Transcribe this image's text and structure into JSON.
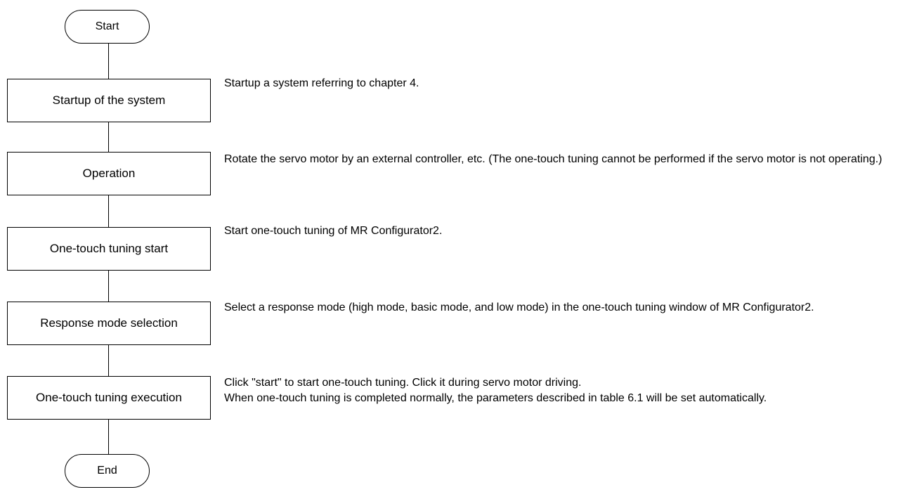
{
  "flowchart": {
    "start_label": "Start",
    "end_label": "End",
    "steps": [
      {
        "label": "Startup of the system",
        "description": [
          "Startup a system referring to chapter 4."
        ]
      },
      {
        "label": "Operation",
        "description": [
          "Rotate the servo motor by an external controller, etc. (The one-touch tuning cannot be performed if the servo motor is not operating.)"
        ]
      },
      {
        "label": "One-touch tuning start",
        "description": [
          "Start one-touch tuning of MR Configurator2."
        ]
      },
      {
        "label": "Response mode selection",
        "description": [
          "Select a response mode (high mode, basic mode, and low mode) in the one-touch tuning window of MR Configurator2."
        ]
      },
      {
        "label": "One-touch tuning execution",
        "description": [
          "Click \"start\" to start one-touch tuning. Click it during servo motor driving.",
          "When one-touch tuning is completed normally, the parameters described in table 6.1 will be set automatically."
        ]
      }
    ]
  }
}
